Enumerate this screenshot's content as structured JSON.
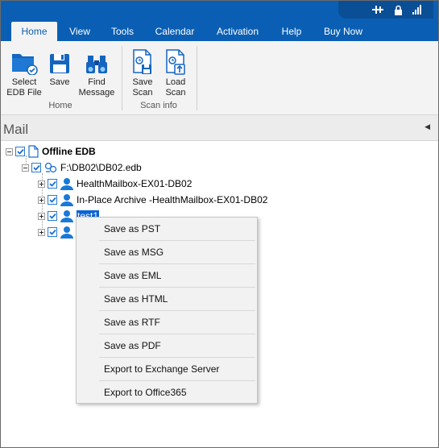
{
  "ribbon_tabs": [
    "Home",
    "View",
    "Tools",
    "Calendar",
    "Activation",
    "Help",
    "Buy Now"
  ],
  "ribbon": {
    "home_group": {
      "label": "Home",
      "select_edb_line1": "Select",
      "select_edb_line2": "EDB File",
      "save": "Save",
      "find_line1": "Find",
      "find_line2": "Message"
    },
    "scan_group": {
      "label": "Scan info",
      "save_scan_line1": "Save",
      "save_scan_line2": "Scan",
      "load_scan_line1": "Load",
      "load_scan_line2": "Scan"
    }
  },
  "panel": {
    "title": "Mail"
  },
  "tree": {
    "root": "Offline EDB",
    "db": "F:\\DB02\\DB02.edb",
    "mailboxes": [
      "HealthMailbox-EX01-DB02",
      "In-Place Archive -HealthMailbox-EX01-DB02",
      "test1",
      ""
    ]
  },
  "context_menu": [
    "Save as PST",
    "Save as MSG",
    "Save as EML",
    "Save as HTML",
    "Save as RTF",
    "Save as PDF",
    "Export to Exchange Server",
    "Export to Office365"
  ],
  "colors": {
    "brand_blue": "#0a5fb4",
    "selection": "#0a64d4",
    "check_blue": "#2a7ad0"
  }
}
